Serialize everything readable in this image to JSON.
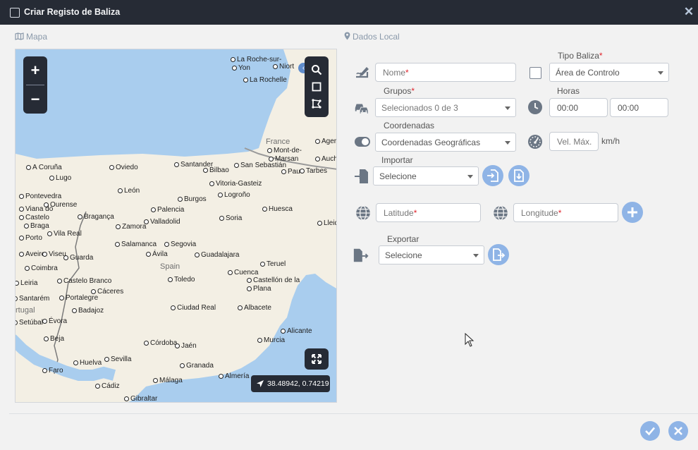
{
  "window": {
    "title": "Criar Registo de Baliza",
    "close_glyph": "✕"
  },
  "sections": {
    "map": "Mapa",
    "location": "Dados Local"
  },
  "map": {
    "zoom_in": "+",
    "zoom_out": "−",
    "collapse_glyph": "‹",
    "coordinates": "38.48942, 0.74219",
    "countries": [
      "France",
      "Spain",
      "rtugal"
    ],
    "cities": [
      "La Roche-sur-",
      "Yon",
      "Niort",
      "La Rochelle",
      "Mont-de-",
      "Marsan",
      "Ager",
      "A Coruña",
      "Oviedo",
      "Santander",
      "Bilbao",
      "San Sebastián",
      "Pau",
      "Tarbes",
      "Auch",
      "Lugo",
      "Vitoria-Gasteiz",
      "Pontevedra",
      "León",
      "Burgos",
      "Logroño",
      "Ourense",
      "Viana do",
      "Castelo",
      "Bragança",
      "Palencia",
      "Huesca",
      "Braga",
      "Zamora",
      "Valladolid",
      "Soria",
      "Lleid",
      "Vila Real",
      "Porto",
      "Salamanca",
      "Segovia",
      "Aveiro",
      "Viseu",
      "Ávila",
      "Guadalajara",
      "Guarda",
      "Coimbra",
      "Teruel",
      "Cuenca",
      "Castelo Branco",
      "Castellón de la",
      "Plana",
      "Leiria",
      "Toledo",
      "Cáceres",
      "Santarém",
      "Portalegre",
      "Ciudad Real",
      "Albacete",
      "Badajoz",
      "Setúbal",
      "Évora",
      "Alicante",
      "Murcia",
      "Beja",
      "Córdoba",
      "Jaén",
      "Huelva",
      "Sevilla",
      "Granada",
      "Faro",
      "Almería",
      "Málaga",
      "Cádiz",
      "Gibraltar"
    ]
  },
  "form": {
    "nome": {
      "placeholder": "Nome",
      "required": "*"
    },
    "tipo_baliza": {
      "label": "Tipo Baliza",
      "required": "*",
      "value": "Área de Controlo"
    },
    "grupos": {
      "label": "Grupos",
      "required": "*",
      "value": "Selecionados 0 de 3"
    },
    "horas": {
      "label": "Horas",
      "start": "00:00",
      "end": "00:00"
    },
    "coordenadas": {
      "label": "Coordenadas",
      "value": "Coordenadas Geográficas"
    },
    "vel_max": {
      "placeholder": "Vel. Máx.",
      "unit": "km/h"
    },
    "importar": {
      "label": "Importar",
      "value": "Selecione"
    },
    "latitude": {
      "placeholder": "Latitude",
      "required": "*"
    },
    "longitude": {
      "placeholder": "Longitude",
      "required": "*"
    },
    "exportar": {
      "label": "Exportar",
      "value": "Selecione"
    }
  },
  "colors": {
    "titlebar": "#262b35",
    "accent_button": "#8fb4e6",
    "required": "#e0232b",
    "sea": "#a9cdee",
    "land": "#f3efe4"
  }
}
